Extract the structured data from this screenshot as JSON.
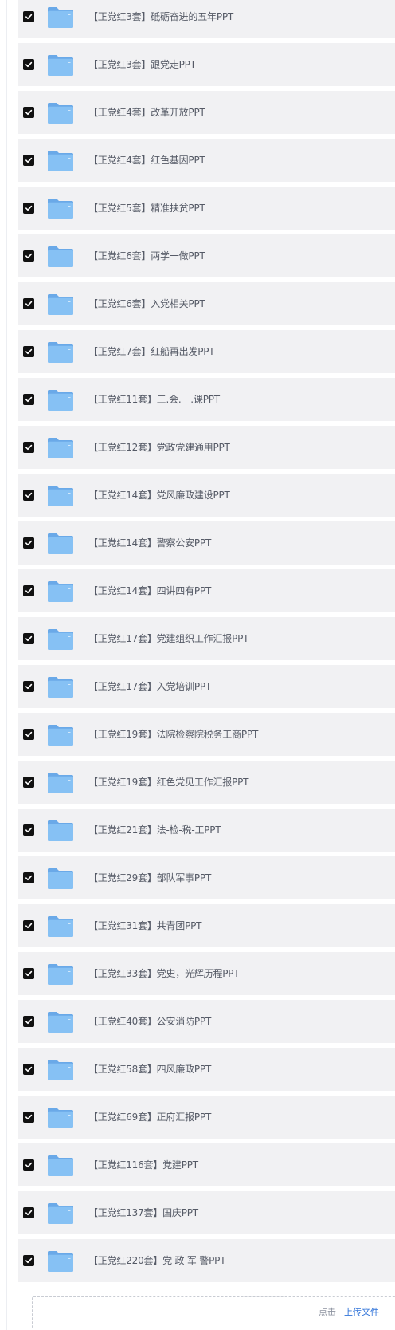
{
  "colors": {
    "row_background": "#f1f1f3",
    "checkbox_checked": "#111111",
    "folder_blue": "#74b3ee",
    "text": "#555a66",
    "link": "#2f73d9"
  },
  "files": [
    {
      "name": "【正党红3套】砥砺奋进的五年PPT",
      "checked": true,
      "icon": "folder-icon"
    },
    {
      "name": "【正党红3套】跟党走PPT",
      "checked": true,
      "icon": "folder-icon"
    },
    {
      "name": "【正党红4套】改革开放PPT",
      "checked": true,
      "icon": "folder-icon"
    },
    {
      "name": "【正党红4套】红色基因PPT",
      "checked": true,
      "icon": "folder-icon"
    },
    {
      "name": "【正党红5套】精准扶贫PPT",
      "checked": true,
      "icon": "folder-icon"
    },
    {
      "name": "【正党红6套】两学一做PPT",
      "checked": true,
      "icon": "folder-icon"
    },
    {
      "name": "【正党红6套】入党相关PPT",
      "checked": true,
      "icon": "folder-icon"
    },
    {
      "name": "【正党红7套】红船再出发PPT",
      "checked": true,
      "icon": "folder-icon"
    },
    {
      "name": "【正党红11套】三.会.一.课PPT",
      "checked": true,
      "icon": "folder-icon"
    },
    {
      "name": "【正党红12套】党政党建通用PPT",
      "checked": true,
      "icon": "folder-icon"
    },
    {
      "name": "【正党红14套】党风廉政建设PPT",
      "checked": true,
      "icon": "folder-icon"
    },
    {
      "name": "【正党红14套】警察公安PPT",
      "checked": true,
      "icon": "folder-icon"
    },
    {
      "name": "【正党红14套】四讲四有PPT",
      "checked": true,
      "icon": "folder-icon"
    },
    {
      "name": "【正党红17套】党建组织工作汇报PPT",
      "checked": true,
      "icon": "folder-icon"
    },
    {
      "name": "【正党红17套】入党培训PPT",
      "checked": true,
      "icon": "folder-icon"
    },
    {
      "name": "【正党红19套】法院检察院税务工商PPT",
      "checked": true,
      "icon": "folder-icon"
    },
    {
      "name": "【正党红19套】红色党见工作汇报PPT",
      "checked": true,
      "icon": "folder-icon"
    },
    {
      "name": "【正党红21套】法-检-税-工PPT",
      "checked": true,
      "icon": "folder-icon"
    },
    {
      "name": "【正党红29套】部队军事PPT",
      "checked": true,
      "icon": "folder-icon"
    },
    {
      "name": "【正党红31套】共青团PPT",
      "checked": true,
      "icon": "folder-icon"
    },
    {
      "name": "【正党红33套】党史，光辉历程PPT",
      "checked": true,
      "icon": "folder-icon"
    },
    {
      "name": "【正党红40套】公安消防PPT",
      "checked": true,
      "icon": "folder-icon"
    },
    {
      "name": "【正党红58套】四风廉政PPT",
      "checked": true,
      "icon": "folder-icon"
    },
    {
      "name": "【正党红69套】正府汇报PPT",
      "checked": true,
      "icon": "folder-icon"
    },
    {
      "name": "【正党红116套】党建PPT",
      "checked": true,
      "icon": "folder-icon"
    },
    {
      "name": "【正党红137套】国庆PPT",
      "checked": true,
      "icon": "folder-icon"
    },
    {
      "name": "【正党红220套】党 政 军 警PPT",
      "checked": true,
      "icon": "folder-icon"
    }
  ],
  "upload": {
    "prompt": "点击",
    "link_label": "上传文件"
  }
}
